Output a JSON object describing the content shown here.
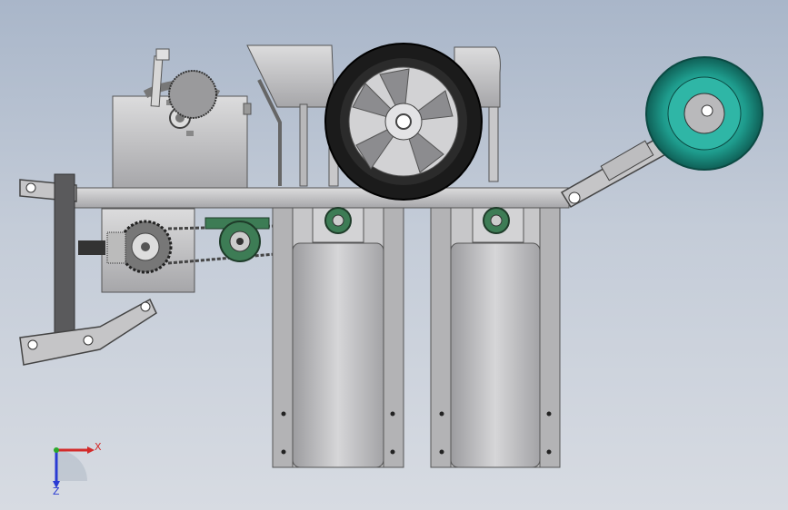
{
  "triad": {
    "x_label": "X",
    "z_label": "Z",
    "x_color": "#d32a2a",
    "z_color": "#2a3bd3",
    "y_color": "#2aa82a"
  },
  "colors": {
    "background_top": "#a9b6c9",
    "background_bottom": "#d7dbe2",
    "metal": "#c4c4c6",
    "metal_dark": "#8d8d90",
    "bearing_green": "#3d7c55",
    "disc_teal": "#1e9c8d",
    "tire": "#1b1b1b"
  },
  "icons": [
    "gear-icon",
    "wheel-icon",
    "bearing-icon",
    "disc-icon",
    "axis-triad-icon"
  ]
}
